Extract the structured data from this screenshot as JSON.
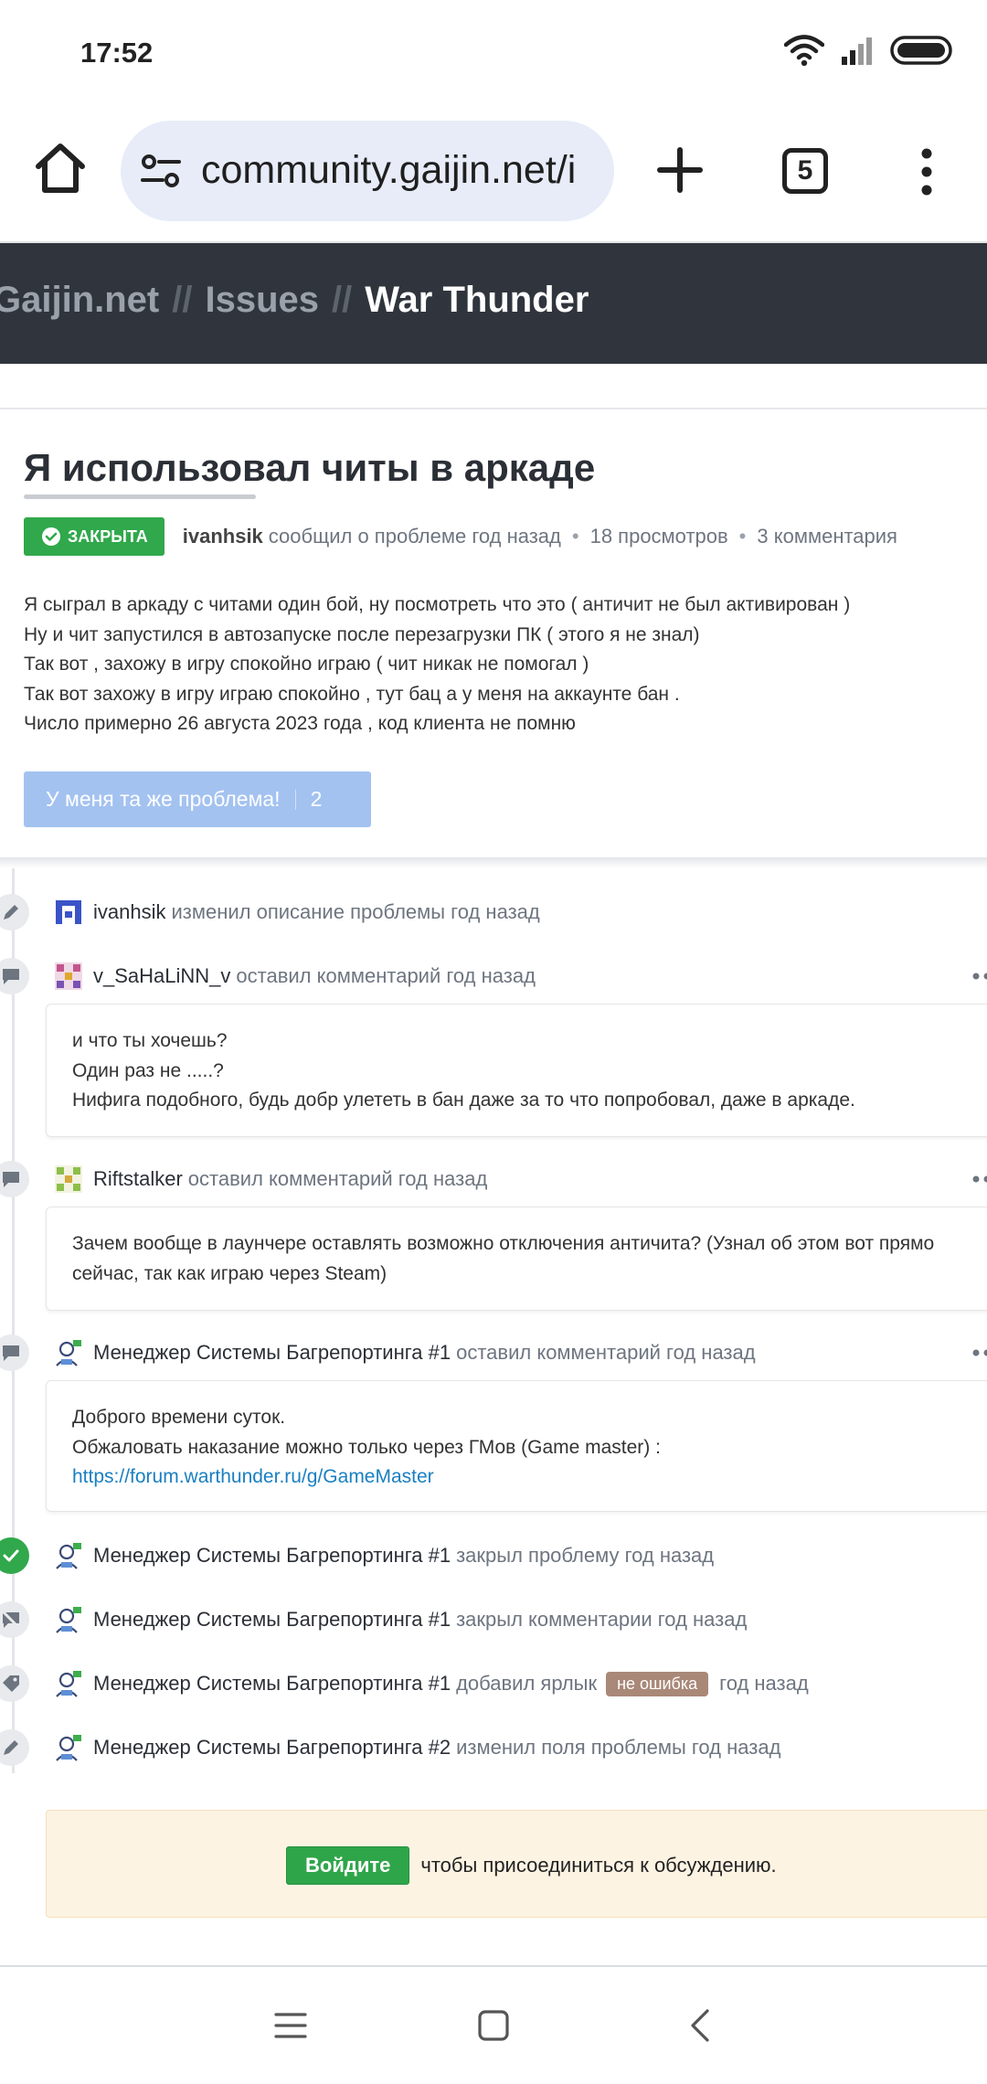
{
  "status_bar": {
    "time": "17:52"
  },
  "browser": {
    "url": "community.gaijin.net/i",
    "tab_count": "5"
  },
  "site_header": {
    "crumbs": [
      "Gaijin.net",
      "Issues",
      "War Thunder"
    ],
    "separator": "//"
  },
  "issue": {
    "title": "Я использовал читы в аркаде",
    "status_badge": "ЗАКРЫТА",
    "author": "ivanhsik",
    "reported_text": "сообщил о проблеме год назад",
    "views": "18 просмотров",
    "comments": "3 комментария",
    "body_lines": [
      "Я сыграл в аркаду с читами один бой, ну посмотреть что это ( античит не был активирован )",
      "Ну и чит запустился в автозапуске после перезагрузки ПК ( этого я не знал)",
      "Так вот , захожу в игру спокойно играю ( чит никак не помогал )",
      "Так вот захожу в игру играю спокойно , тут бац а у меня на аккаунте бан .",
      "Число примерно 26 августа 2023 года , код клиента не помню"
    ],
    "same_problem_label": "У меня та же проблема!",
    "same_problem_count": "2"
  },
  "timeline": {
    "e1": {
      "name": "ivanhsik",
      "action": "изменил описание проблемы год назад"
    },
    "e2": {
      "name": "v_SaHaLiNN_v",
      "action": "оставил комментарий год назад",
      "comment": [
        "и что ты хочешь?",
        "Один раз не .....?",
        "Нифига подобного, будь добр улететь в бан даже за то что попробовал, даже в аркаде."
      ]
    },
    "e3": {
      "name": "Riftstalker",
      "action": "оставил комментарий год назад",
      "comment": [
        "Зачем вообще в лаунчере оставлять возможно отключения античита? (Узнал об этом вот прямо",
        "сейчас, так как играю через Steam)"
      ]
    },
    "e4": {
      "name": "Менеджер Системы Багрепортинга #1",
      "action": "оставил комментарий год назад",
      "comment": [
        "Доброго времени суток.",
        "Обжаловать наказание можно только через ГМов (Game master) :"
      ],
      "link": "https://forum.warthunder.ru/g/GameMaster"
    },
    "e5": {
      "name": "Менеджер Системы Багрепортинга #1",
      "action": "закрыл проблему год назад"
    },
    "e6": {
      "name": "Менеджер Системы Багрепортинга #1",
      "action": "закрыл комментарии год назад"
    },
    "e7": {
      "name": "Менеджер Системы Багрепортинга #1",
      "action": "добавил ярлык",
      "label": "не ошибка",
      "time": "год назад"
    },
    "e8": {
      "name": "Менеджер Системы Багрепортинга #2",
      "action": "изменил поля проблемы год назад"
    }
  },
  "join": {
    "button": "Войдите",
    "text": "чтобы присоединиться к обсуждению."
  },
  "colors": {
    "header_bg": "#30353d",
    "closed_green": "#30a84b",
    "same_btn": "#a3c2f0",
    "label_chip": "#a98878",
    "join_bg": "#fdf3e3",
    "link": "#1a7fc1"
  }
}
